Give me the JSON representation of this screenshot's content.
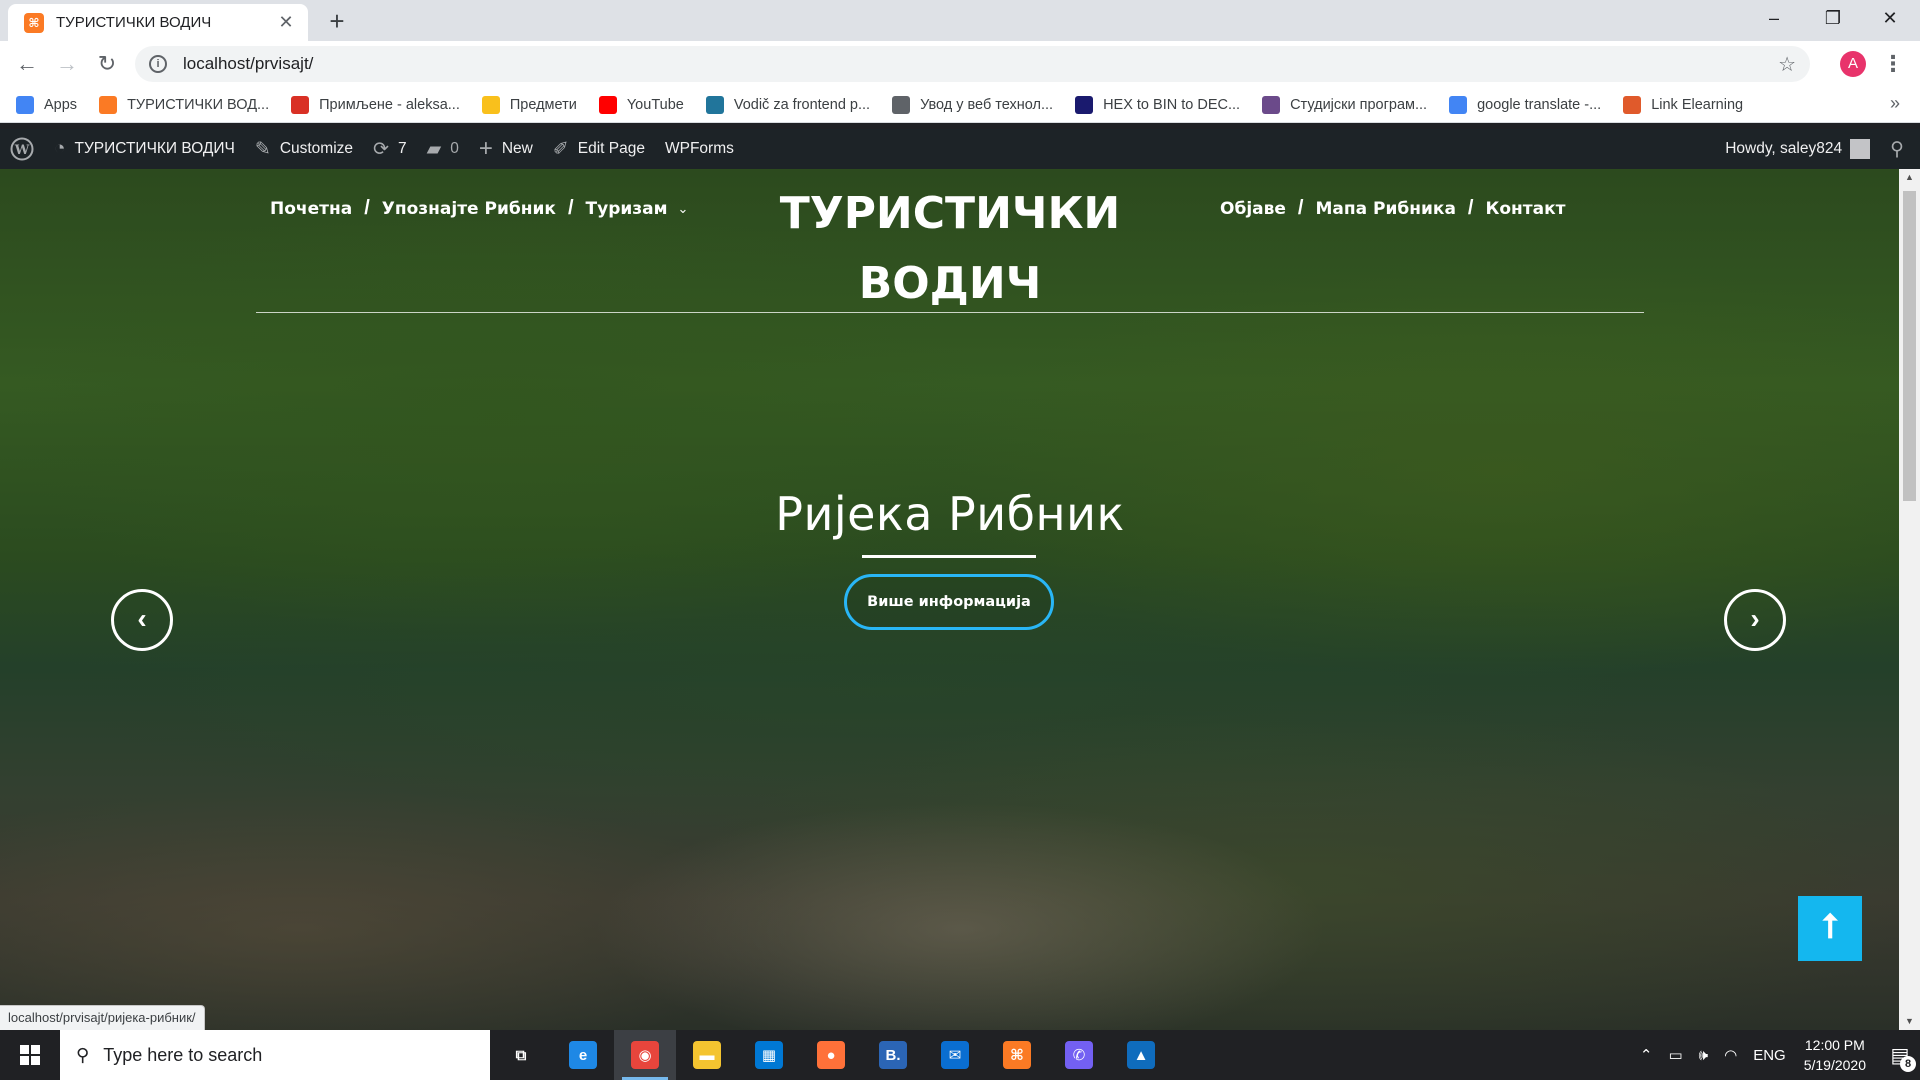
{
  "browser": {
    "tab_title": "ТУРИСТИЧКИ ВОДИЧ",
    "tab_favicon_text": "⌘",
    "url": "localhost/prvisajt/",
    "avatar_letter": "A",
    "window_controls": [
      "–",
      "❐",
      "✕"
    ]
  },
  "bookmarks": [
    {
      "label": "Apps",
      "icon": "apps-grid-icon",
      "color": "#4285f4"
    },
    {
      "label": "ТУРИСТИЧКИ ВОД...",
      "icon": "xampp-icon",
      "color": "#fb7a24"
    },
    {
      "label": "Примљене - aleksa...",
      "icon": "gmail-icon",
      "color": "#d93025"
    },
    {
      "label": "Предмети",
      "icon": "folder-icon",
      "color": "#f9c01c"
    },
    {
      "label": "YouTube",
      "icon": "youtube-icon",
      "color": "#ff0000"
    },
    {
      "label": "Vodič za frontend p...",
      "icon": "wordpress-icon",
      "color": "#21759b"
    },
    {
      "label": "Увод у веб технол...",
      "icon": "globe-icon",
      "color": "#5f6368"
    },
    {
      "label": "HEX to BIN to DEC...",
      "icon": "converter-icon",
      "color": "#1a1a6e"
    },
    {
      "label": "Студијски програм...",
      "icon": "university-icon",
      "color": "#6b4a8a"
    },
    {
      "label": "google translate -...",
      "icon": "google-icon",
      "color": "#4285f4"
    },
    {
      "label": "Link Elearning",
      "icon": "elearning-icon",
      "color": "#e05a2b"
    }
  ],
  "wp_admin_bar": {
    "site_name": "ТУРИСТИЧКИ ВОДИЧ",
    "customize": "Customize",
    "updates_count": "7",
    "comments_count": "0",
    "new_label": "New",
    "edit_page": "Edit Page",
    "wpforms": "WPForms",
    "howdy": "Howdy, saley824"
  },
  "site": {
    "title": "ТУРИСТИЧКИ ВОДИЧ",
    "nav_left": [
      "Почетна",
      "Упознајте Рибник",
      "Туризам"
    ],
    "nav_right": [
      "Објаве",
      "Мапа Рибника",
      "Контакт"
    ],
    "separator": "/"
  },
  "slider": {
    "title": "Ријека Рибник",
    "button": "Више информација",
    "prev": "‹",
    "next": "›"
  },
  "back_to_top": "⭡",
  "status_url": "localhost/prvisajt/ријека-рибник/",
  "taskbar": {
    "search_placeholder": "Type here to search",
    "apps": [
      {
        "name": "task-view-icon",
        "glyph": "⧉",
        "color": "transparent"
      },
      {
        "name": "edge-icon",
        "glyph": "e",
        "color": "#1e88e5"
      },
      {
        "name": "chrome-icon",
        "glyph": "◉",
        "color": "#e8453c"
      },
      {
        "name": "file-explorer-icon",
        "glyph": "▬",
        "color": "#f4c430"
      },
      {
        "name": "store-icon",
        "glyph": "▦",
        "color": "#0078d4"
      },
      {
        "name": "firefox-icon",
        "glyph": "●",
        "color": "#ff7139"
      },
      {
        "name": "bootstrap-studio-icon",
        "glyph": "B.",
        "color": "#2b65b5"
      },
      {
        "name": "mail-icon",
        "glyph": "✉",
        "color": "#0a6ed1"
      },
      {
        "name": "xampp-icon",
        "glyph": "⌘",
        "color": "#fb7a24"
      },
      {
        "name": "viber-icon",
        "glyph": "✆",
        "color": "#7360f2"
      },
      {
        "name": "photos-icon",
        "glyph": "▲",
        "color": "#0f6cbd"
      }
    ],
    "language": "ENG",
    "time": "12:00 PM",
    "date": "5/19/2020",
    "notifications": "8"
  }
}
